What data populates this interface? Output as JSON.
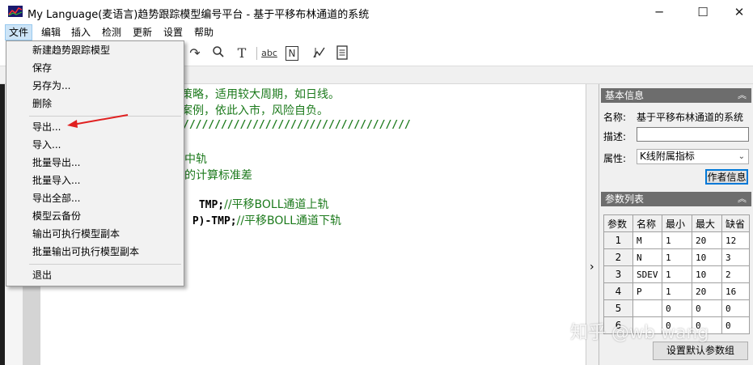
{
  "window": {
    "title": "My Language(麦语言)趋势跟踪模型编号平台 - 基于平移布林通道的系统",
    "minimize": "─",
    "maximize": "☐",
    "close": "✕"
  },
  "menubar": [
    "文件",
    "编辑",
    "插入",
    "检测",
    "更新",
    "设置",
    "帮助"
  ],
  "toolbar_icons": [
    "redo-icon",
    "search-icon",
    "text-icon",
    "spellcheck-icon",
    "n-document-icon",
    "chart-pen-icon",
    "document-icon"
  ],
  "toolbar_glyphs": {
    "redo": "↷",
    "search": "🔍︎",
    "text": "T",
    "spell": "abc",
    "ndoc": "N",
    "chart": "✎",
    "doc": "📄︎"
  },
  "file_menu": {
    "items": [
      "新建趋势跟踪模型",
      "保存",
      "另存为...",
      "删除",
      "导出...",
      "导入...",
      "批量导出...",
      "批量导入...",
      "导出全部...",
      "模型云备份",
      "输出可执行模型副本",
      "批量输出可执行模型副本",
      "退出"
    ]
  },
  "editor": {
    "lines": [
      "易策略，适用较大周期，如日线。",
      "发案例，依此入市，风险自负。",
      "////////////////////////////////////",
      "",
      "中轨",
      "的计算标准差",
      "TMP;",
      "//平移BOLL通道上轨",
      "P)-TMP;",
      "//平移BOLL通道下轨"
    ]
  },
  "collapse_arrow": "›",
  "basic_info": {
    "header": "基本信息",
    "name_label": "名称:",
    "name_value": "基于平移布林通道的系统",
    "desc_label": "描述:",
    "desc_value": "",
    "attr_label": "属性:",
    "attr_value": "K线附属指标",
    "author_button": "作者信息"
  },
  "param_list": {
    "header": "参数列表",
    "columns": [
      "参数",
      "名称",
      "最小",
      "最大",
      "缺省"
    ],
    "rows": [
      [
        "1",
        "M",
        "1",
        "20",
        "12"
      ],
      [
        "2",
        "N",
        "1",
        "10",
        "3"
      ],
      [
        "3",
        "SDEV",
        "1",
        "10",
        "2"
      ],
      [
        "4",
        "P",
        "1",
        "20",
        "16"
      ],
      [
        "5",
        "",
        "0",
        "0",
        "0"
      ],
      [
        "6",
        "",
        "0",
        "0",
        "0"
      ]
    ],
    "default_button": "设置默认参数组"
  },
  "watermark": "知乎 @wb wang",
  "colors": {
    "code_green": "#1c7a1c",
    "panel_header": "#6d6d6d",
    "annotation_red": "#e02020"
  }
}
